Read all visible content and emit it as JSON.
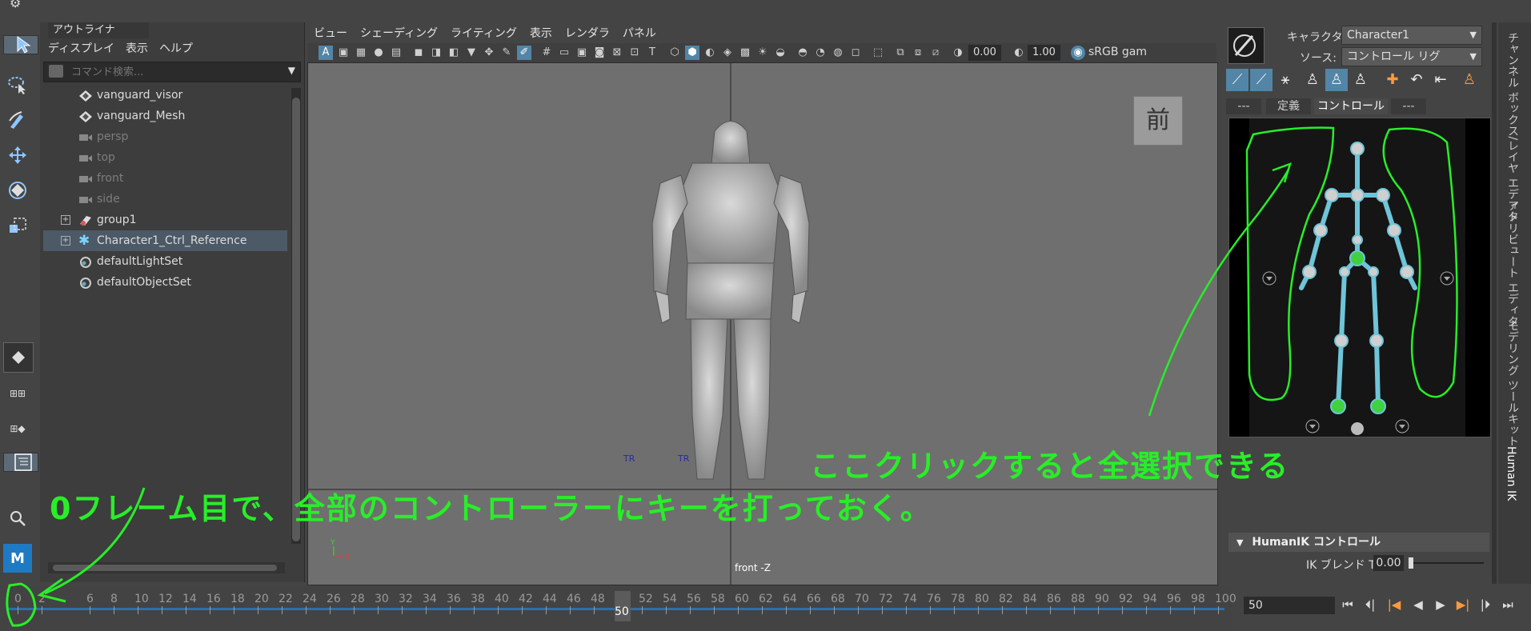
{
  "outliner": {
    "title": "アウトライナ",
    "menu": [
      "ディスプレイ",
      "表示",
      "ヘルプ"
    ],
    "search_placeholder": "コマンド検索...",
    "items": [
      {
        "label": "vanguard_visor",
        "icon": "mesh-icon",
        "dim": false
      },
      {
        "label": "vanguard_Mesh",
        "icon": "mesh-icon",
        "dim": false
      },
      {
        "label": "persp",
        "icon": "camera-icon",
        "dim": true
      },
      {
        "label": "top",
        "icon": "camera-icon",
        "dim": true
      },
      {
        "label": "front",
        "icon": "camera-icon",
        "dim": true
      },
      {
        "label": "side",
        "icon": "camera-icon",
        "dim": true
      },
      {
        "label": "group1",
        "icon": "group-icon",
        "dim": false
      },
      {
        "label": "Character1_Ctrl_Reference",
        "icon": "joint-icon",
        "dim": false
      },
      {
        "label": "defaultLightSet",
        "icon": "set-icon",
        "dim": false
      },
      {
        "label": "defaultObjectSet",
        "icon": "set-icon",
        "dim": false
      }
    ]
  },
  "viewport": {
    "menu": [
      "ビュー",
      "シェーディング",
      "ライティング",
      "表示",
      "レンダラ",
      "パネル"
    ],
    "exposure": "0.00",
    "gamma": "1.00",
    "colorspace": "sRGB gam",
    "camera_label": "前",
    "view_name": "front -Z",
    "axis_y": "Y",
    "axis_x": "X",
    "marker_left": "TR",
    "marker_right": "TR"
  },
  "hik": {
    "character_label": "キャラクタ:",
    "character_value": "Character1",
    "source_label": "ソース:",
    "source_value": "コントロール リグ",
    "tabs": [
      "---",
      "定義",
      "コントロール",
      "---"
    ],
    "controls_header": "HumanIK コントロール",
    "ik_blend_label": "IK ブレンド T",
    "ik_blend_value": "0.00"
  },
  "side_tabs": [
    "チャンネル ボックス/レイヤ エディタ",
    "アトリビュート エディタ",
    "モデリング ツールキット",
    "Human IK"
  ],
  "timeline": {
    "labels": [
      "0",
      "2",
      "6",
      "8",
      "10",
      "12",
      "14",
      "16",
      "18",
      "20",
      "22",
      "24",
      "26",
      "28",
      "30",
      "32",
      "34",
      "36",
      "38",
      "40",
      "42",
      "44",
      "46",
      "48",
      "50",
      "52",
      "54",
      "56",
      "58",
      "60",
      "62",
      "64",
      "66",
      "68",
      "70",
      "72",
      "74",
      "76",
      "78",
      "80",
      "82",
      "84",
      "86",
      "88",
      "90",
      "92",
      "94",
      "96",
      "98",
      "100"
    ],
    "current_marker": "50",
    "current_frame": "50"
  },
  "annotations": {
    "text1": "ここクリックすると全選択できる",
    "text2": "0フレーム目で、全部のコントローラーにキーを打っておく。"
  },
  "colors": {
    "annotation": "#28ee28",
    "selected": "#5285a6",
    "hik_green": "#3fd13f"
  }
}
